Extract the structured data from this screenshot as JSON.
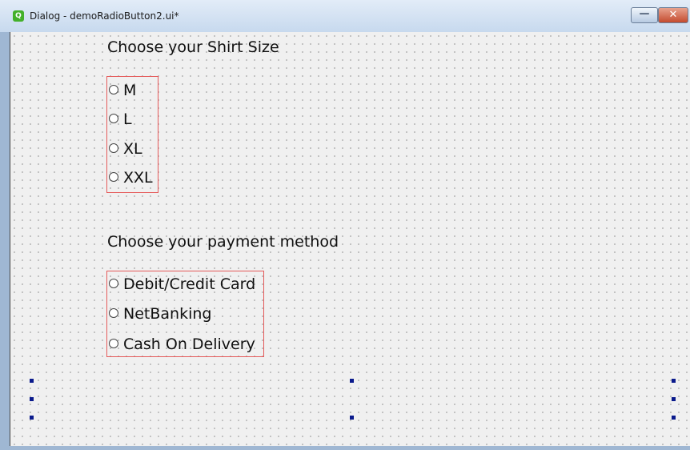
{
  "window": {
    "title": "Dialog - demoRadioButton2.ui*",
    "app_icon_glyph": "Q",
    "minimize_glyph": "—",
    "close_glyph": "✕"
  },
  "shirt_size": {
    "heading": "Choose your Shirt Size",
    "options": [
      {
        "label": "M",
        "checked": false
      },
      {
        "label": "L",
        "checked": false
      },
      {
        "label": "XL",
        "checked": false
      },
      {
        "label": "XXL",
        "checked": false
      }
    ]
  },
  "payment": {
    "heading": "Choose your payment method",
    "options": [
      {
        "label": "Debit/Credit Card",
        "checked": false
      },
      {
        "label": "NetBanking",
        "checked": false
      },
      {
        "label": "Cash On Delivery",
        "checked": false
      }
    ]
  },
  "colors": {
    "selection_border": "#e55a5a",
    "handle": "#0a1a8c",
    "canvas": "#f0f0f0"
  }
}
